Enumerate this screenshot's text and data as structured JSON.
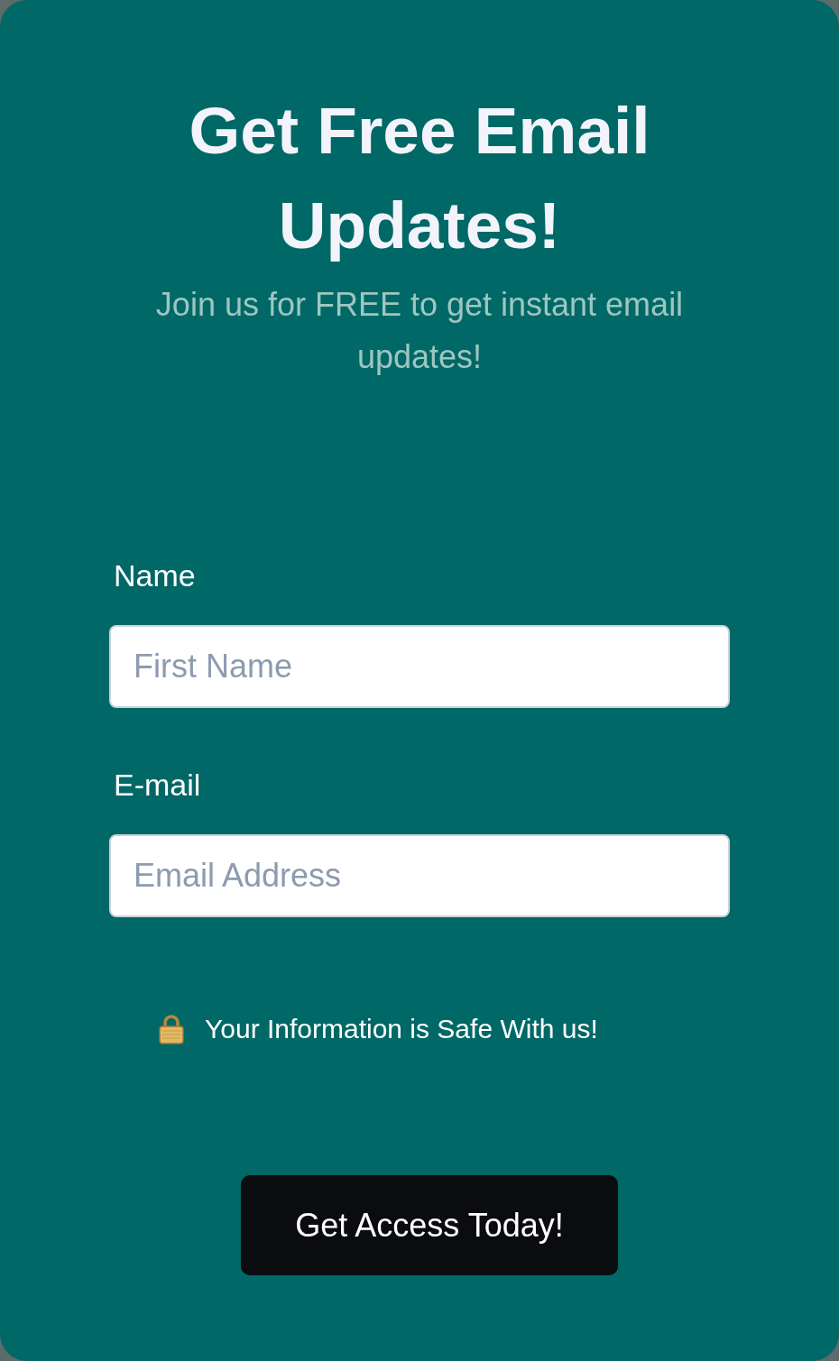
{
  "title": "Get Free Email Updates!",
  "subtitle": "Join us for FREE to get instant email updates!",
  "fields": [
    {
      "label": "Name",
      "placeholder": "First Name"
    },
    {
      "label": "E-mail",
      "placeholder": "Email Address"
    }
  ],
  "privacy_note": "Your Information is Safe With us!",
  "submit_button": "Get Access Today!"
}
